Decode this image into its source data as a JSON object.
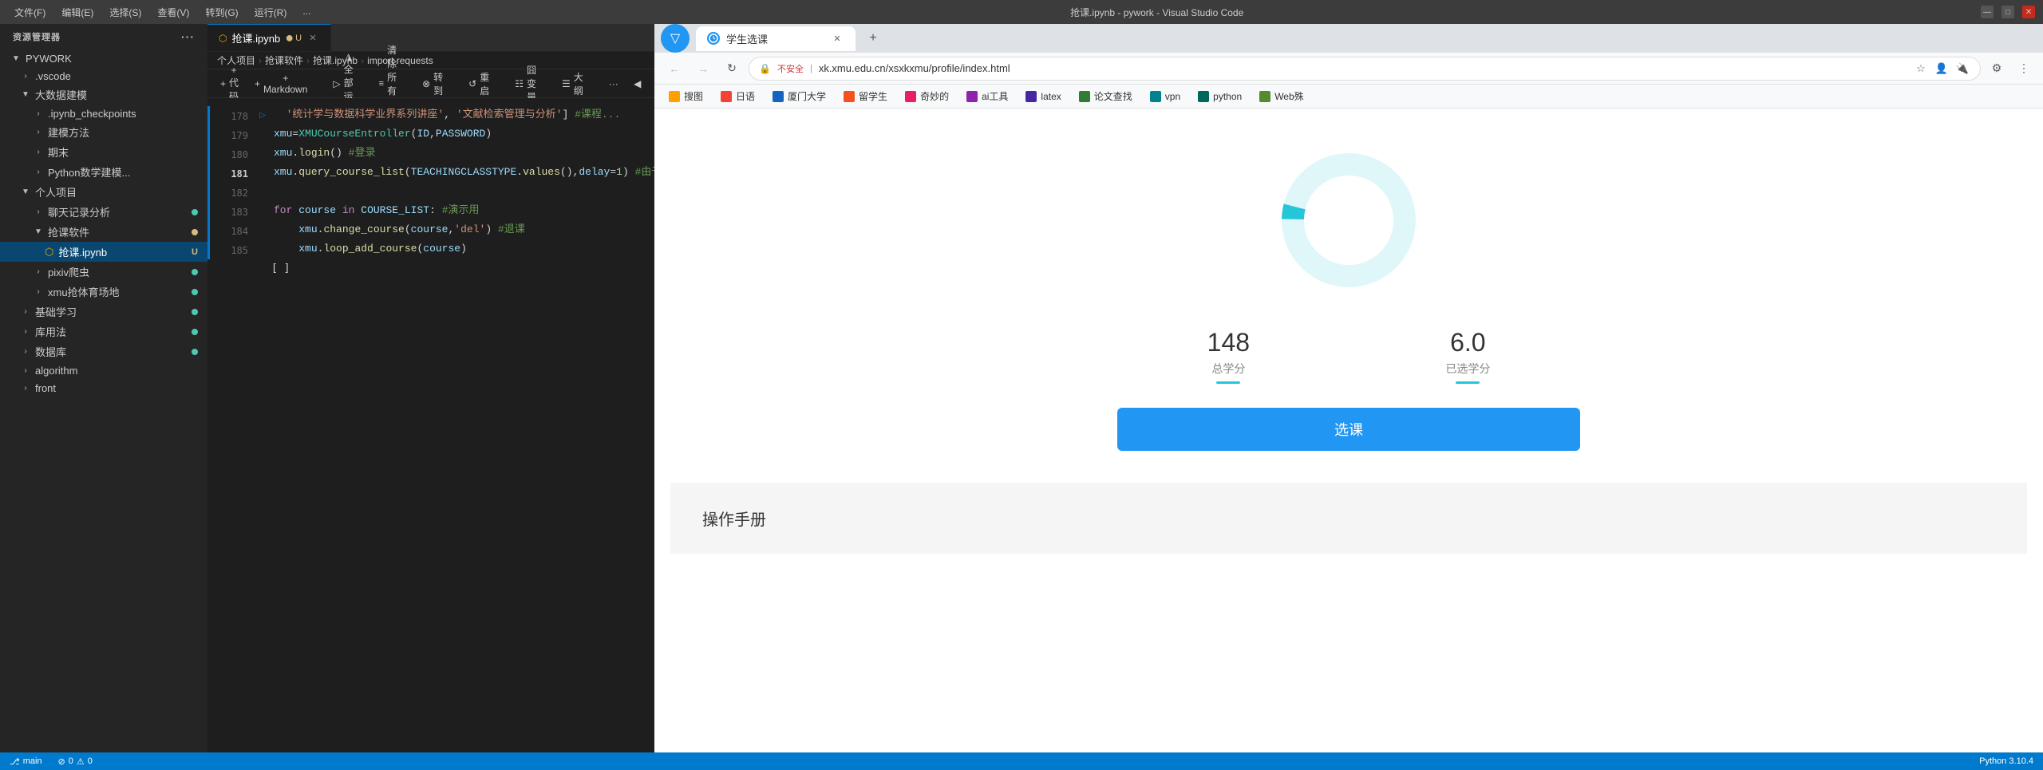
{
  "titleBar": {
    "menus": [
      "文件(F)",
      "编辑(E)",
      "选择(S)",
      "查看(V)",
      "转到(G)",
      "运行(R)",
      "..."
    ],
    "title": "抢课.ipynb - pywork - Visual Studio Code"
  },
  "sidebar": {
    "header": "资源管理器",
    "moreLabel": "···",
    "sections": [
      {
        "id": "pywork",
        "label": "PYWORK",
        "expanded": true,
        "items": [
          {
            "id": "vscode",
            "label": ".vscode",
            "type": "folder",
            "depth": 1,
            "expanded": false
          },
          {
            "id": "bigdata",
            "label": "大数据建模",
            "type": "folder",
            "depth": 1,
            "expanded": true
          },
          {
            "id": "ipynb_checkpoints",
            "label": ".ipynb_checkpoints",
            "type": "folder",
            "depth": 2,
            "expanded": false
          },
          {
            "id": "modeling",
            "label": "建模方法",
            "type": "folder",
            "depth": 2,
            "expanded": false
          },
          {
            "id": "final",
            "label": "期末",
            "type": "folder",
            "depth": 2,
            "expanded": false
          },
          {
            "id": "python-modeling",
            "label": "Python数学建模...",
            "type": "folder",
            "depth": 2,
            "expanded": false
          },
          {
            "id": "personal",
            "label": "个人项目",
            "type": "folder",
            "depth": 1,
            "expanded": true
          },
          {
            "id": "chat-analysis",
            "label": "聊天记录分析",
            "type": "folder",
            "depth": 2,
            "expanded": false,
            "status": "green"
          },
          {
            "id": "qiangke-software",
            "label": "抢课软件",
            "type": "folder",
            "depth": 2,
            "expanded": true,
            "status": "yellow"
          },
          {
            "id": "qiangke-ipynb",
            "label": "抢课.ipynb",
            "type": "file",
            "depth": 3,
            "modified": "U",
            "active": true
          },
          {
            "id": "pixiv-crawler",
            "label": "pixiv爬虫",
            "type": "folder",
            "depth": 2,
            "expanded": false,
            "status": "green"
          },
          {
            "id": "xmu-gym",
            "label": "xmu抢体育场地",
            "type": "folder",
            "depth": 2,
            "expanded": false,
            "status": "green"
          },
          {
            "id": "basic-learning",
            "label": "基础学习",
            "type": "folder",
            "depth": 1,
            "expanded": false,
            "status": "green"
          },
          {
            "id": "algorithms",
            "label": "库用法",
            "type": "folder",
            "depth": 1,
            "expanded": false,
            "status": "green"
          },
          {
            "id": "database",
            "label": "数据库",
            "type": "folder",
            "depth": 1,
            "expanded": false,
            "status": "green"
          },
          {
            "id": "algorithm",
            "label": "algorithm",
            "type": "folder",
            "depth": 1,
            "expanded": false
          },
          {
            "id": "front",
            "label": "front",
            "type": "folder",
            "depth": 1,
            "expanded": false
          }
        ]
      }
    ]
  },
  "tabs": [
    {
      "id": "qiangke-tab",
      "label": "抢课.ipynb",
      "icon": "notebook",
      "modified": true,
      "active": true
    },
    {
      "id": "close",
      "label": "✕"
    }
  ],
  "breadcrumb": {
    "items": [
      "个人项目",
      "抢课软件",
      "抢课.ipynb",
      "import requests"
    ]
  },
  "toolbar": {
    "addCode": "+ 代码",
    "addMarkdown": "+ Markdown",
    "runAll": "◮ 全部运行",
    "clearAll": "清除所有输出",
    "convert": "转到",
    "restart": "重启",
    "variables": "囧 变量",
    "outline": "大纲"
  },
  "codeLines": [
    {
      "lineNum": "178",
      "content": "  '统计学与数据科学业界系列讲座', '文献检索管理与分析'] #课程..."
    },
    {
      "lineNum": "179",
      "content": "xmu=XMUCourseEntroller(ID,PASSWORD)"
    },
    {
      "lineNum": "180",
      "content": "xmu.login() #登录"
    },
    {
      "lineNum": "181",
      "content": "xmu.query_course_list(TEACHINGCLASSTYPE.values(),delay=1) #由于每次密钥不一样,不..."
    },
    {
      "lineNum": "182",
      "content": ""
    },
    {
      "lineNum": "183",
      "content": "for course in COURSE_LIST: #演示用"
    },
    {
      "lineNum": "184",
      "content": "    xmu.change_course(course,'del') #退课"
    },
    {
      "lineNum": "185",
      "content": "    xmu.loop_add_course(course)"
    }
  ],
  "cellOutput": "[ ]",
  "browser": {
    "filterIcon": "▼",
    "tabTitle": "学生选课",
    "tabClose": "✕",
    "newTab": "+",
    "navBack": "←",
    "navForward": "→",
    "reload": "↻",
    "addressBar": {
      "lock": "🔒",
      "insecure": "不安全",
      "url": "xk.xmu.edu.cn/xsxkxmu/profile/index.html"
    },
    "bookmarks": [
      {
        "label": "搜图",
        "color": "#ffa000"
      },
      {
        "label": "日语",
        "color": "#f44336"
      },
      {
        "label": "厦门大学",
        "color": "#1565c0"
      },
      {
        "label": "留学生",
        "color": "#f4511e"
      },
      {
        "label": "奇妙的",
        "color": "#e91e63"
      },
      {
        "label": "ai工具",
        "color": "#8e24aa"
      },
      {
        "label": "latex",
        "color": "#4527a0"
      },
      {
        "label": "论文查找",
        "color": "#2e7d32"
      },
      {
        "label": "vpn",
        "color": "#00838f"
      },
      {
        "label": "python",
        "color": "#00695c"
      },
      {
        "label": "Web殊",
        "color": "#558b2f"
      }
    ],
    "stats": {
      "totalCredits": "148",
      "totalCreditsLabel": "总学分",
      "earnedCredits": "6.0",
      "earnedCreditsLabel": "已选学分"
    },
    "selectCourseBtn": "选课",
    "footer": {
      "title": "操作手册"
    },
    "donut": {
      "total": 148,
      "filled": 6,
      "color": "#26c6da",
      "bgColor": "#e0f7fa"
    }
  },
  "statusBar": {
    "items": [
      "main",
      "Python 3.10.4"
    ]
  }
}
